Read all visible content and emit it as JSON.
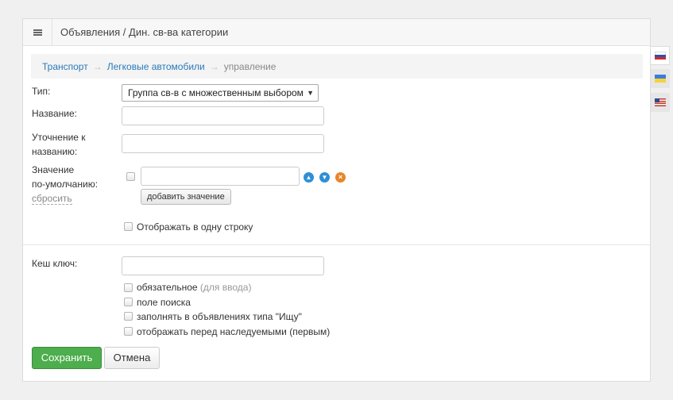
{
  "header": {
    "title": "Объявления / Дин. св-ва категории"
  },
  "breadcrumb": {
    "items": [
      "Транспорт",
      "Легковые автомобили"
    ],
    "separator": "→",
    "current": "управление"
  },
  "form": {
    "type": {
      "label": "Тип:",
      "selected": "Группа св-в с множественным выбором"
    },
    "name": {
      "label": "Название:",
      "value": ""
    },
    "clarification": {
      "label_line1": "Уточнение к",
      "label_line2": "названию:",
      "value": ""
    },
    "default_value": {
      "label_line1": "Значение",
      "label_line2": "по-умолчанию:",
      "reset_link": "сбросить",
      "value": "",
      "add_button": "добавить значение"
    },
    "single_line": {
      "label": "Отображать в одну строку",
      "checked": false
    },
    "cache_key": {
      "label": "Кеш ключ:",
      "value": ""
    },
    "required": {
      "label": "обязательное",
      "hint": "(для ввода)",
      "checked": false
    },
    "search_field": {
      "label": "поле поиска",
      "checked": false
    },
    "fill_wanted": {
      "label": "заполнять в объявлениях типа \"Ищу\"",
      "checked": false
    },
    "show_before_inherited": {
      "label": "отображать перед наследуемыми (первым)",
      "checked": false
    }
  },
  "actions": {
    "save": "Сохранить",
    "cancel": "Отмена"
  },
  "languages": [
    {
      "code": "ru",
      "icon": "flag-russia-icon",
      "active": true
    },
    {
      "code": "uk",
      "icon": "flag-ukraine-icon",
      "active": false
    },
    {
      "code": "en",
      "icon": "flag-usa-icon",
      "active": false
    }
  ],
  "colors": {
    "accent": "#2a7ab8",
    "save": "#4cae4c",
    "arrow_buttons": "#2f8fd6",
    "delete_button": "#e8862a"
  }
}
